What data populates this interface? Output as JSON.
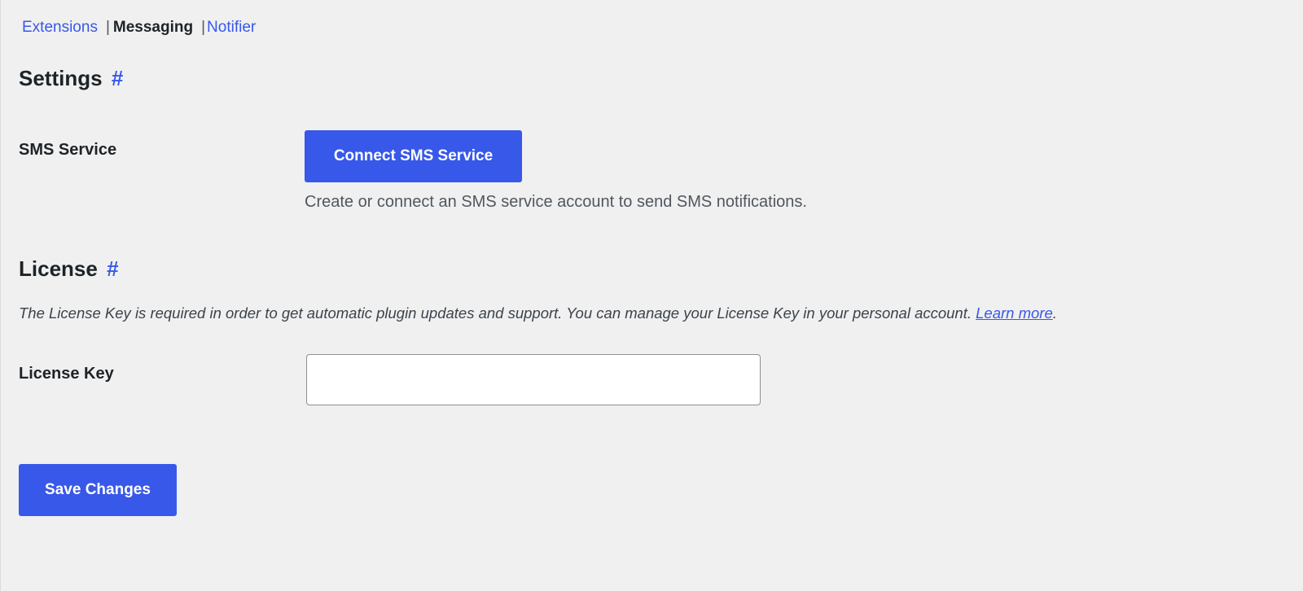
{
  "subnav": {
    "extensions": "Extensions",
    "separator": "|",
    "messaging": "Messaging",
    "notifier": "Notifier"
  },
  "settings": {
    "heading": "Settings",
    "anchor": "#",
    "sms_service": {
      "label": "SMS Service",
      "button_label": "Connect SMS Service",
      "description": "Create or connect an SMS service account to send SMS notifications."
    }
  },
  "license": {
    "heading": "License",
    "anchor": "#",
    "intro_text": "The License Key is required in order to get automatic plugin updates and support. You can manage your License Key in your personal account.",
    "learn_more": "Learn more",
    "intro_end": ".",
    "key_label": "License Key",
    "key_value": "",
    "key_placeholder": ""
  },
  "footer": {
    "save_label": "Save Changes"
  },
  "colors": {
    "accent": "#3858e9",
    "background": "#f0f0f1",
    "text": "#1d2327",
    "muted_text": "#50575e"
  }
}
